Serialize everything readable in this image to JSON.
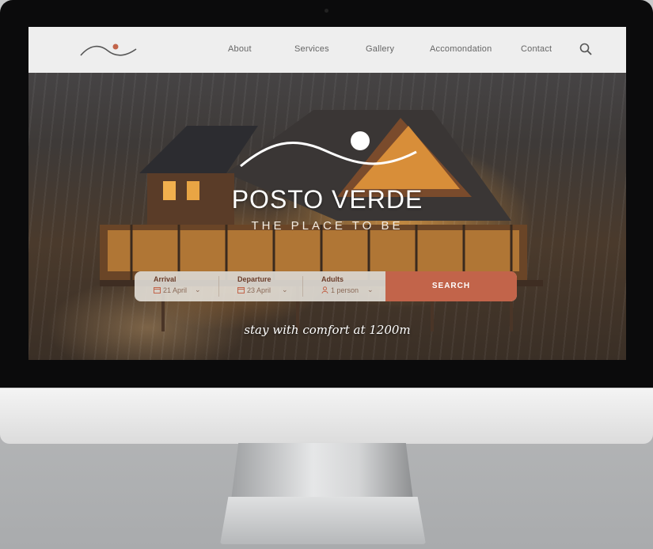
{
  "nav": {
    "links": [
      "About",
      "Services",
      "Gallery",
      "Accomondation",
      "Contact"
    ]
  },
  "hero": {
    "title": "POSTO VERDE",
    "subtitle": "THE PLACE TO BE",
    "tagline": "stay with comfort at 1200m"
  },
  "booking": {
    "arrival_label": "Arrival",
    "arrival_value": "21 April",
    "departure_label": "Departure",
    "departure_value": "23 April",
    "adults_label": "Adults",
    "adults_value": "1 person",
    "search_label": "SEARCH"
  },
  "icons": [
    "search-icon",
    "calendar-icon",
    "person-icon",
    "chevron-down-icon"
  ],
  "colors": {
    "accent": "#c2644a",
    "navbar": "#eeeeee",
    "label": "#6b3d2a"
  }
}
